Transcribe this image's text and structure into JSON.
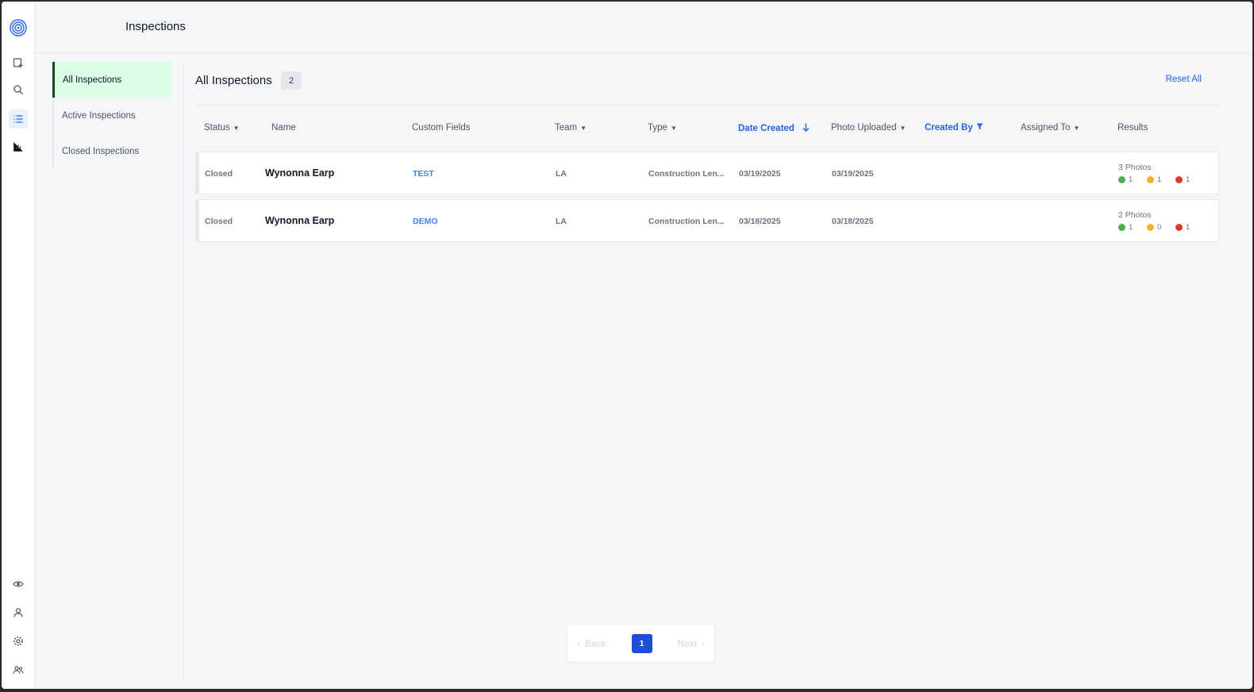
{
  "header": {
    "title": "Inspections"
  },
  "rail": {
    "top_icons": [
      "new-inspection-icon",
      "search-icon",
      "list-icon",
      "chart-icon"
    ],
    "bottom_icons": [
      "eye-icon",
      "user-icon",
      "gear-icon",
      "team-icon"
    ],
    "accent": "#2563eb"
  },
  "subnav": {
    "items": [
      {
        "label": "All Inspections",
        "active": true
      },
      {
        "label": "Active Inspections",
        "active": false
      },
      {
        "label": "Closed Inspections",
        "active": false
      }
    ]
  },
  "main": {
    "title": "All Inspections",
    "count": "2",
    "reset_label": "Reset All"
  },
  "columns": {
    "status": "Status",
    "name": "Name",
    "custom_fields": "Custom Fields",
    "team": "Team",
    "type": "Type",
    "date_created": "Date Created",
    "photo_uploaded": "Photo Uploaded",
    "created_by": "Created By",
    "assigned_to": "Assigned To",
    "results": "Results"
  },
  "rows": [
    {
      "status": "Closed",
      "name": "Wynonna Earp",
      "custom_field": "TEST",
      "team": "LA",
      "type": "Construction Len...",
      "date_created": "03/19/2025",
      "photo_uploaded": "03/19/2025",
      "created_by": "",
      "assigned_to": "",
      "photos": "3 Photos",
      "green": "1",
      "yellow": "1",
      "red": "1"
    },
    {
      "status": "Closed",
      "name": "Wynonna Earp",
      "custom_field": "DEMO",
      "team": "LA",
      "type": "Construction Len...",
      "date_created": "03/18/2025",
      "photo_uploaded": "03/18/2025",
      "created_by": "",
      "assigned_to": "",
      "photos": "2 Photos",
      "green": "1",
      "yellow": "0",
      "red": "1"
    }
  ],
  "status_colors": {
    "green": "#4caf50",
    "yellow": "#f0b429",
    "red": "#d93a2b"
  },
  "pager": {
    "back": "Back",
    "page": "1",
    "next": "Next"
  }
}
